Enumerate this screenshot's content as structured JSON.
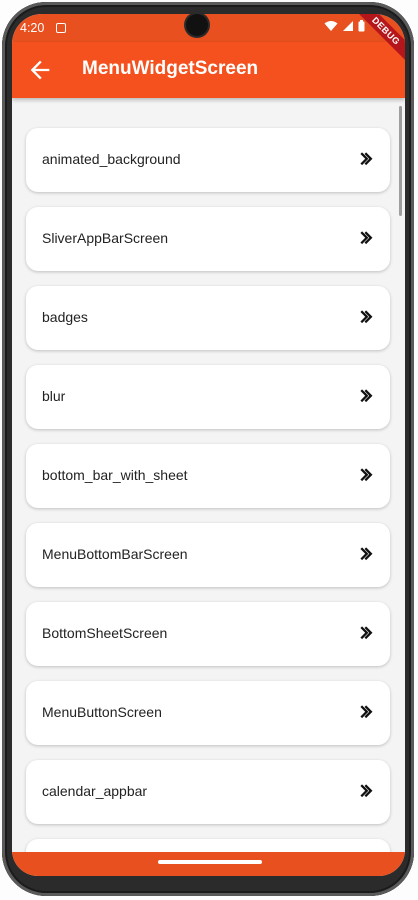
{
  "status_bar": {
    "time": "4:20",
    "debug_label": "DEBUG"
  },
  "app_bar": {
    "title": "MenuWidgetScreen",
    "back_icon": "arrow-back-icon",
    "background_color": "#f4511e"
  },
  "menu": {
    "items": [
      {
        "label": "animated_background"
      },
      {
        "label": "SliverAppBarScreen"
      },
      {
        "label": "badges"
      },
      {
        "label": "blur"
      },
      {
        "label": "bottom_bar_with_sheet"
      },
      {
        "label": "MenuBottomBarScreen"
      },
      {
        "label": "BottomSheetScreen"
      },
      {
        "label": "MenuButtonScreen"
      },
      {
        "label": "calendar_appbar"
      },
      {
        "label": ""
      }
    ],
    "chevron_icon": "double-chevron-right-icon"
  }
}
